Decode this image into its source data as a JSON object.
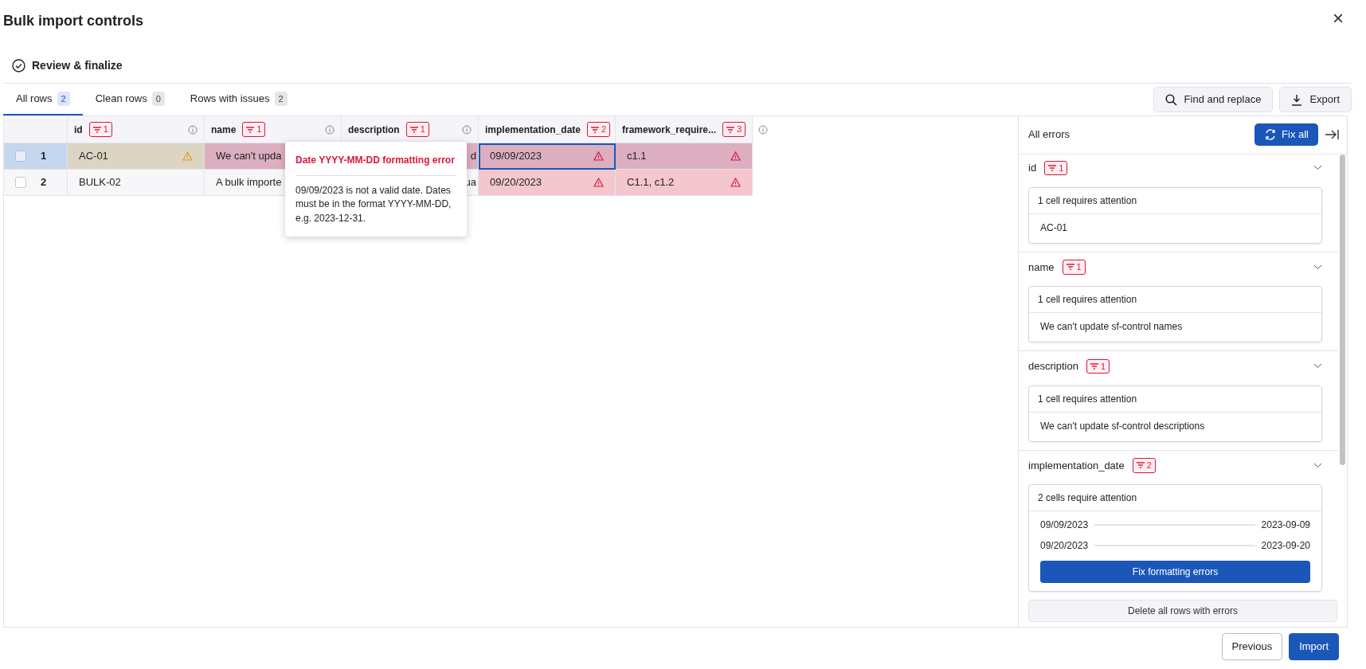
{
  "dialog": {
    "title": "Bulk import controls",
    "close": "×"
  },
  "step": {
    "label": "Review & finalize"
  },
  "tabs": [
    {
      "label": "All rows",
      "count": "2",
      "selected": true
    },
    {
      "label": "Clean rows",
      "count": "0",
      "selected": false
    },
    {
      "label": "Rows with issues",
      "count": "2",
      "selected": false
    }
  ],
  "toolbar": [
    {
      "label": "Find and replace",
      "kind": "search"
    },
    {
      "label": "Export",
      "kind": "export"
    }
  ],
  "table": {
    "columns": [
      {
        "label": "id",
        "count": "1"
      },
      {
        "label": "name",
        "count": "1"
      },
      {
        "label": "description",
        "count": "1"
      },
      {
        "label": "implementation_date",
        "count": "2"
      },
      {
        "label": "framework_require...",
        "count": "3"
      }
    ],
    "rows": [
      {
        "number": "1",
        "selected": true,
        "cells": [
          {
            "text": "AC-01",
            "kind": "warning",
            "alert_icon": true,
            "focused": false
          },
          {
            "text": "We can't upda",
            "kind": "error",
            "alert_icon": false,
            "focused": false
          },
          {
            "text": "d",
            "kind": "error",
            "alert_icon": false,
            "focused": false
          },
          {
            "text": "09/09/2023",
            "kind": "error",
            "alert_icon": true,
            "focused": true
          },
          {
            "text": "c1.1",
            "kind": "error",
            "alert_icon": true,
            "focused": false
          }
        ]
      },
      {
        "number": "2",
        "selected": false,
        "cells": [
          {
            "text": "BULK-02",
            "kind": "plain",
            "alert_icon": false,
            "focused": false
          },
          {
            "text": "A bulk importe",
            "kind": "plain",
            "alert_icon": false,
            "focused": false
          },
          {
            "text": "ua",
            "kind": "plain",
            "alert_icon": false,
            "focused": false
          },
          {
            "text": "09/20/2023",
            "kind": "error",
            "alert_icon": true,
            "focused": false
          },
          {
            "text": "C1.1, c1.2",
            "kind": "error",
            "alert_icon": true,
            "focused": false
          }
        ]
      }
    ]
  },
  "tooltip": {
    "title": "Date YYYY-MM-DD formatting error",
    "body": "09/09/2023 is not a valid date. Dates must be in the format YYYY-MM-DD, e.g. 2023-12-31."
  },
  "errors_panel": {
    "title": "All errors",
    "fix_all": "Fix all",
    "sections": [
      {
        "field": "id",
        "count": "1",
        "expanded": true,
        "summary": "1 cell requires attention",
        "items": [
          {
            "kind": "value",
            "text": "AC-01"
          }
        ]
      },
      {
        "field": "name",
        "count": "1",
        "expanded": true,
        "summary": "1 cell requires attention",
        "items": [
          {
            "kind": "value",
            "text": "We can't update sf-control names"
          }
        ]
      },
      {
        "field": "description",
        "count": "1",
        "expanded": true,
        "summary": "1 cell requires attention",
        "items": [
          {
            "kind": "value",
            "text": "We can't update sf-control descriptions"
          }
        ]
      },
      {
        "field": "implementation_date",
        "count": "2",
        "expanded": true,
        "summary": "2 cells require attention",
        "items": [
          {
            "kind": "change",
            "from": "09/09/2023",
            "to": "2023-09-09"
          },
          {
            "kind": "change",
            "from": "09/20/2023",
            "to": "2023-09-20"
          }
        ],
        "action": "Fix formatting errors"
      }
    ],
    "delete_all": "Delete all rows with errors"
  },
  "footer": {
    "buttons": [
      {
        "label": "Previous",
        "kind": "secondary"
      },
      {
        "label": "Import",
        "kind": "primary"
      }
    ]
  }
}
